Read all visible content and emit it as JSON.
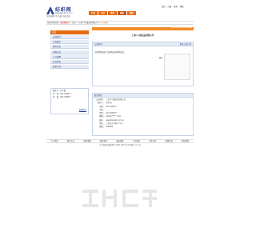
{
  "header": {
    "logo_text": "纺织网",
    "logo_url": "www.texnet.com.cn",
    "slogan": "中国·网络平台·纺织行业服务商",
    "top_links": [
      "首页",
      "注册",
      "登录",
      "帮助"
    ],
    "nav_tabs": [
      "产品",
      "企业",
      "资讯",
      "商机",
      "展会"
    ]
  },
  "breadcrumb": {
    "prefix": "您现在的位置：",
    "home": "纺织网首页",
    "sep1": " > ",
    "mid": "企业 > 上海××纺织品有限公司",
    "sep2": " > ",
    "current": "公司首页"
  },
  "sidebar": {
    "header": "首页",
    "items": [
      "公司简介",
      "产品展厅",
      "供应信息",
      "求购信息",
      "人才招聘",
      "营业执照",
      "联系方式"
    ],
    "contact": [
      "联系人：何小姐",
      "电　话：021-5963**",
      "传　真：021-5963**"
    ],
    "contact_link": "给我留言"
  },
  "main": {
    "strip_text": "Welcome to our company",
    "company_name": "上海××纺织品有限公司",
    "intro_title": "公司简介",
    "intro_more": "更多公司介绍",
    "intro_text": "主要经营纺织产品原料及面料等各类。",
    "photo_label": "图片",
    "contact_title": "联系我们",
    "details": [
      {
        "k": "公司名称：",
        "v": "上海××纺织品有限公司"
      },
      {
        "k": "联系人：",
        "v": "何小姐"
      },
      {
        "k": "电话：",
        "v": "021-5963**"
      },
      {
        "k": "手机：",
        "v": "—"
      },
      {
        "k": "传真：",
        "v": "021-5963**"
      },
      {
        "k": "邮箱：",
        "v": "kefu@*****.com"
      },
      {
        "k": "网址：",
        "v": "www.texnet.com.cn"
      },
      {
        "k": "地址：",
        "v": "上海市××路×××号"
      },
      {
        "k": "邮编：",
        "v": "200000"
      }
    ]
  },
  "footer": {
    "links": [
      "关于我们",
      "联系方式",
      "网站地图",
      "服务条款",
      "隐私政策",
      "广告服务",
      "合作伙伴",
      "招聘信息",
      "网站帮助"
    ],
    "copyright": "© 纺织网 版权所有 1997-2019 沪ICP备××××号"
  },
  "colors": {
    "accent": "#e46a12",
    "brand": "#2a3f8f",
    "watermark": "#e6e6e6"
  }
}
